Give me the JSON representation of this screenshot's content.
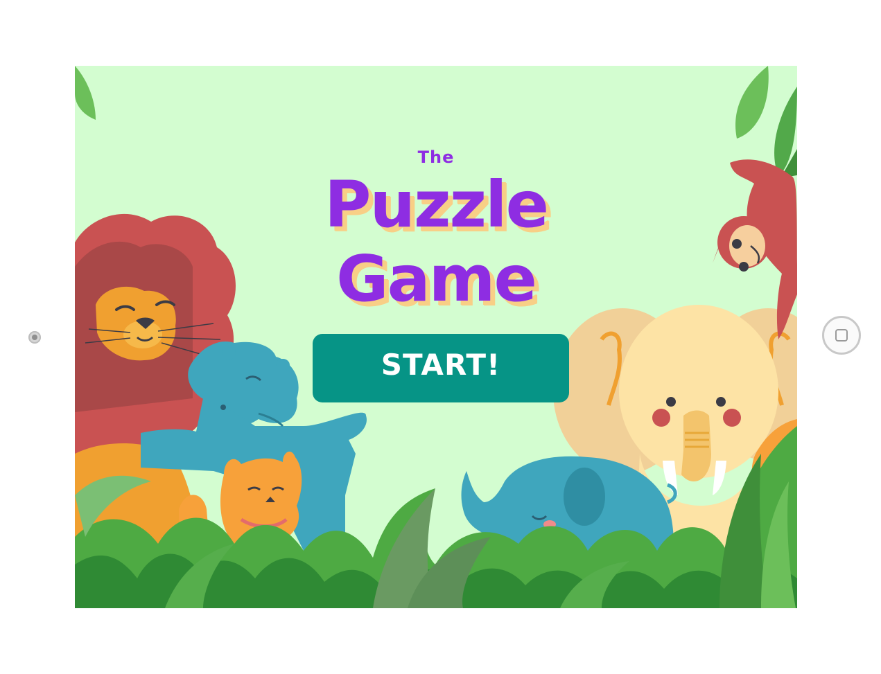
{
  "title": {
    "the": "The",
    "line1": "Puzzle",
    "line2": "Game"
  },
  "start_button": {
    "label": "START!"
  },
  "colors": {
    "background": "#d3fdd0",
    "title": "#8e2de2",
    "title_shadow": "#f8cf86",
    "button": "#069486",
    "button_text": "#ffffff"
  },
  "illustrations": [
    "lion",
    "hippo",
    "cat",
    "baby-elephant",
    "big-elephant",
    "monkey",
    "orange-cat",
    "jungle-leaves"
  ]
}
